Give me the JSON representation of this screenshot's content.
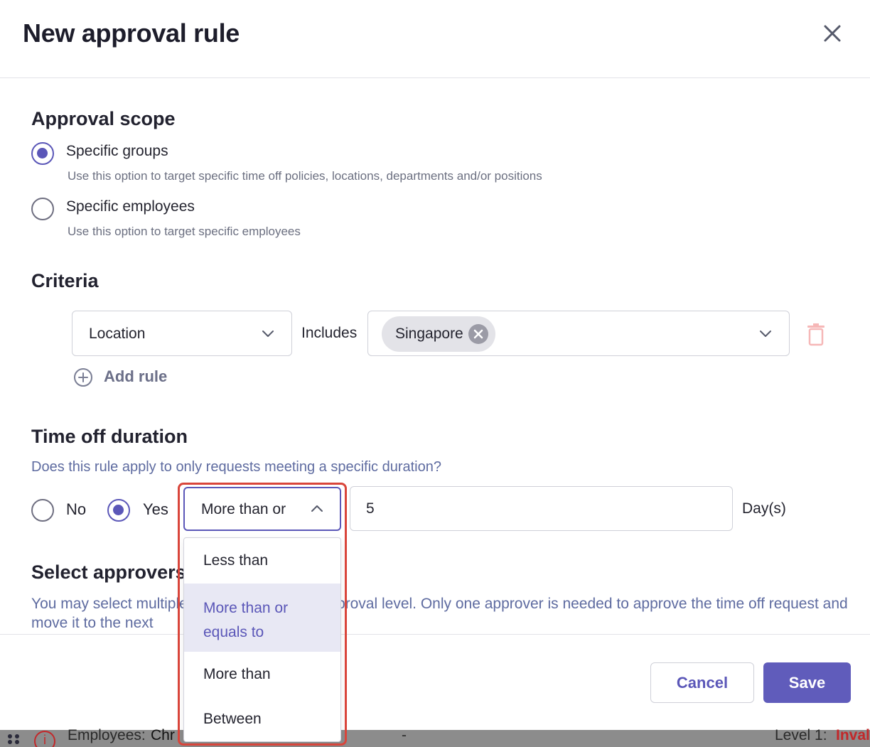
{
  "modal": {
    "title": "New approval rule",
    "close_icon": "close-icon"
  },
  "approval_scope": {
    "title": "Approval scope",
    "options": [
      {
        "label": "Specific groups",
        "help": "Use this option to target specific time off policies, locations, departments and/or positions",
        "selected": true
      },
      {
        "label": "Specific employees",
        "help": "Use this option to target specific employees",
        "selected": false
      }
    ]
  },
  "criteria": {
    "title": "Criteria",
    "field_value": "Location",
    "operator": "Includes",
    "chips": [
      "Singapore"
    ],
    "add_rule_label": "Add rule",
    "icons": {
      "field_chevron": "chevron-down-icon",
      "remove_chip": "close-circle-icon",
      "delete": "trash-icon",
      "add": "plus-circle-icon"
    }
  },
  "time_off_duration": {
    "title": "Time off duration",
    "question": "Does this rule apply to only requests meeting a specific duration?",
    "options": [
      {
        "label": "No",
        "selected": false
      },
      {
        "label": "Yes",
        "selected": true
      }
    ],
    "comparison_value": "More than or",
    "amount_value": "5",
    "unit": "Day(s)",
    "dropdown_open": true,
    "dropdown_options": [
      {
        "label": "Less than",
        "selected": false
      },
      {
        "label": "More than or equals to",
        "line1": "More than or",
        "line2": "equals to",
        "selected": true
      },
      {
        "label": "More than",
        "selected": false
      },
      {
        "label": "Between",
        "selected": false
      }
    ],
    "highlight_color": "#d9453b"
  },
  "select_approvers": {
    "title": "Select approvers",
    "help": "You may select multiple approvers for each approval level. Only one approver is needed to approve the time off request and move it to the next"
  },
  "footer": {
    "cancel_label": "Cancel",
    "save_label": "Save"
  },
  "background_row": {
    "employees_label": "Employees:",
    "employees_value": "Chr",
    "dash": "-",
    "level_label": "Level 1:",
    "status": "Inval"
  },
  "colors": {
    "accent": "#5b57b8",
    "save_button": "#605cbb",
    "muted_text": "#5e6ba0",
    "error": "#c2282a"
  }
}
